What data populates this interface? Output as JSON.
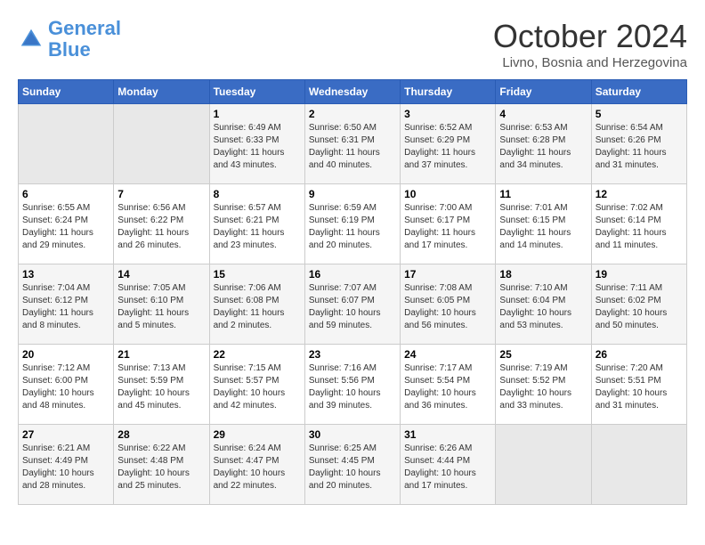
{
  "header": {
    "logo_line1": "General",
    "logo_line2": "Blue",
    "month": "October 2024",
    "location": "Livno, Bosnia and Herzegovina"
  },
  "weekdays": [
    "Sunday",
    "Monday",
    "Tuesday",
    "Wednesday",
    "Thursday",
    "Friday",
    "Saturday"
  ],
  "weeks": [
    [
      {
        "day": "",
        "sunrise": "",
        "sunset": "",
        "daylight": ""
      },
      {
        "day": "",
        "sunrise": "",
        "sunset": "",
        "daylight": ""
      },
      {
        "day": "1",
        "sunrise": "Sunrise: 6:49 AM",
        "sunset": "Sunset: 6:33 PM",
        "daylight": "Daylight: 11 hours and 43 minutes."
      },
      {
        "day": "2",
        "sunrise": "Sunrise: 6:50 AM",
        "sunset": "Sunset: 6:31 PM",
        "daylight": "Daylight: 11 hours and 40 minutes."
      },
      {
        "day": "3",
        "sunrise": "Sunrise: 6:52 AM",
        "sunset": "Sunset: 6:29 PM",
        "daylight": "Daylight: 11 hours and 37 minutes."
      },
      {
        "day": "4",
        "sunrise": "Sunrise: 6:53 AM",
        "sunset": "Sunset: 6:28 PM",
        "daylight": "Daylight: 11 hours and 34 minutes."
      },
      {
        "day": "5",
        "sunrise": "Sunrise: 6:54 AM",
        "sunset": "Sunset: 6:26 PM",
        "daylight": "Daylight: 11 hours and 31 minutes."
      }
    ],
    [
      {
        "day": "6",
        "sunrise": "Sunrise: 6:55 AM",
        "sunset": "Sunset: 6:24 PM",
        "daylight": "Daylight: 11 hours and 29 minutes."
      },
      {
        "day": "7",
        "sunrise": "Sunrise: 6:56 AM",
        "sunset": "Sunset: 6:22 PM",
        "daylight": "Daylight: 11 hours and 26 minutes."
      },
      {
        "day": "8",
        "sunrise": "Sunrise: 6:57 AM",
        "sunset": "Sunset: 6:21 PM",
        "daylight": "Daylight: 11 hours and 23 minutes."
      },
      {
        "day": "9",
        "sunrise": "Sunrise: 6:59 AM",
        "sunset": "Sunset: 6:19 PM",
        "daylight": "Daylight: 11 hours and 20 minutes."
      },
      {
        "day": "10",
        "sunrise": "Sunrise: 7:00 AM",
        "sunset": "Sunset: 6:17 PM",
        "daylight": "Daylight: 11 hours and 17 minutes."
      },
      {
        "day": "11",
        "sunrise": "Sunrise: 7:01 AM",
        "sunset": "Sunset: 6:15 PM",
        "daylight": "Daylight: 11 hours and 14 minutes."
      },
      {
        "day": "12",
        "sunrise": "Sunrise: 7:02 AM",
        "sunset": "Sunset: 6:14 PM",
        "daylight": "Daylight: 11 hours and 11 minutes."
      }
    ],
    [
      {
        "day": "13",
        "sunrise": "Sunrise: 7:04 AM",
        "sunset": "Sunset: 6:12 PM",
        "daylight": "Daylight: 11 hours and 8 minutes."
      },
      {
        "day": "14",
        "sunrise": "Sunrise: 7:05 AM",
        "sunset": "Sunset: 6:10 PM",
        "daylight": "Daylight: 11 hours and 5 minutes."
      },
      {
        "day": "15",
        "sunrise": "Sunrise: 7:06 AM",
        "sunset": "Sunset: 6:08 PM",
        "daylight": "Daylight: 11 hours and 2 minutes."
      },
      {
        "day": "16",
        "sunrise": "Sunrise: 7:07 AM",
        "sunset": "Sunset: 6:07 PM",
        "daylight": "Daylight: 10 hours and 59 minutes."
      },
      {
        "day": "17",
        "sunrise": "Sunrise: 7:08 AM",
        "sunset": "Sunset: 6:05 PM",
        "daylight": "Daylight: 10 hours and 56 minutes."
      },
      {
        "day": "18",
        "sunrise": "Sunrise: 7:10 AM",
        "sunset": "Sunset: 6:04 PM",
        "daylight": "Daylight: 10 hours and 53 minutes."
      },
      {
        "day": "19",
        "sunrise": "Sunrise: 7:11 AM",
        "sunset": "Sunset: 6:02 PM",
        "daylight": "Daylight: 10 hours and 50 minutes."
      }
    ],
    [
      {
        "day": "20",
        "sunrise": "Sunrise: 7:12 AM",
        "sunset": "Sunset: 6:00 PM",
        "daylight": "Daylight: 10 hours and 48 minutes."
      },
      {
        "day": "21",
        "sunrise": "Sunrise: 7:13 AM",
        "sunset": "Sunset: 5:59 PM",
        "daylight": "Daylight: 10 hours and 45 minutes."
      },
      {
        "day": "22",
        "sunrise": "Sunrise: 7:15 AM",
        "sunset": "Sunset: 5:57 PM",
        "daylight": "Daylight: 10 hours and 42 minutes."
      },
      {
        "day": "23",
        "sunrise": "Sunrise: 7:16 AM",
        "sunset": "Sunset: 5:56 PM",
        "daylight": "Daylight: 10 hours and 39 minutes."
      },
      {
        "day": "24",
        "sunrise": "Sunrise: 7:17 AM",
        "sunset": "Sunset: 5:54 PM",
        "daylight": "Daylight: 10 hours and 36 minutes."
      },
      {
        "day": "25",
        "sunrise": "Sunrise: 7:19 AM",
        "sunset": "Sunset: 5:52 PM",
        "daylight": "Daylight: 10 hours and 33 minutes."
      },
      {
        "day": "26",
        "sunrise": "Sunrise: 7:20 AM",
        "sunset": "Sunset: 5:51 PM",
        "daylight": "Daylight: 10 hours and 31 minutes."
      }
    ],
    [
      {
        "day": "27",
        "sunrise": "Sunrise: 6:21 AM",
        "sunset": "Sunset: 4:49 PM",
        "daylight": "Daylight: 10 hours and 28 minutes."
      },
      {
        "day": "28",
        "sunrise": "Sunrise: 6:22 AM",
        "sunset": "Sunset: 4:48 PM",
        "daylight": "Daylight: 10 hours and 25 minutes."
      },
      {
        "day": "29",
        "sunrise": "Sunrise: 6:24 AM",
        "sunset": "Sunset: 4:47 PM",
        "daylight": "Daylight: 10 hours and 22 minutes."
      },
      {
        "day": "30",
        "sunrise": "Sunrise: 6:25 AM",
        "sunset": "Sunset: 4:45 PM",
        "daylight": "Daylight: 10 hours and 20 minutes."
      },
      {
        "day": "31",
        "sunrise": "Sunrise: 6:26 AM",
        "sunset": "Sunset: 4:44 PM",
        "daylight": "Daylight: 10 hours and 17 minutes."
      },
      {
        "day": "",
        "sunrise": "",
        "sunset": "",
        "daylight": ""
      },
      {
        "day": "",
        "sunrise": "",
        "sunset": "",
        "daylight": ""
      }
    ]
  ]
}
